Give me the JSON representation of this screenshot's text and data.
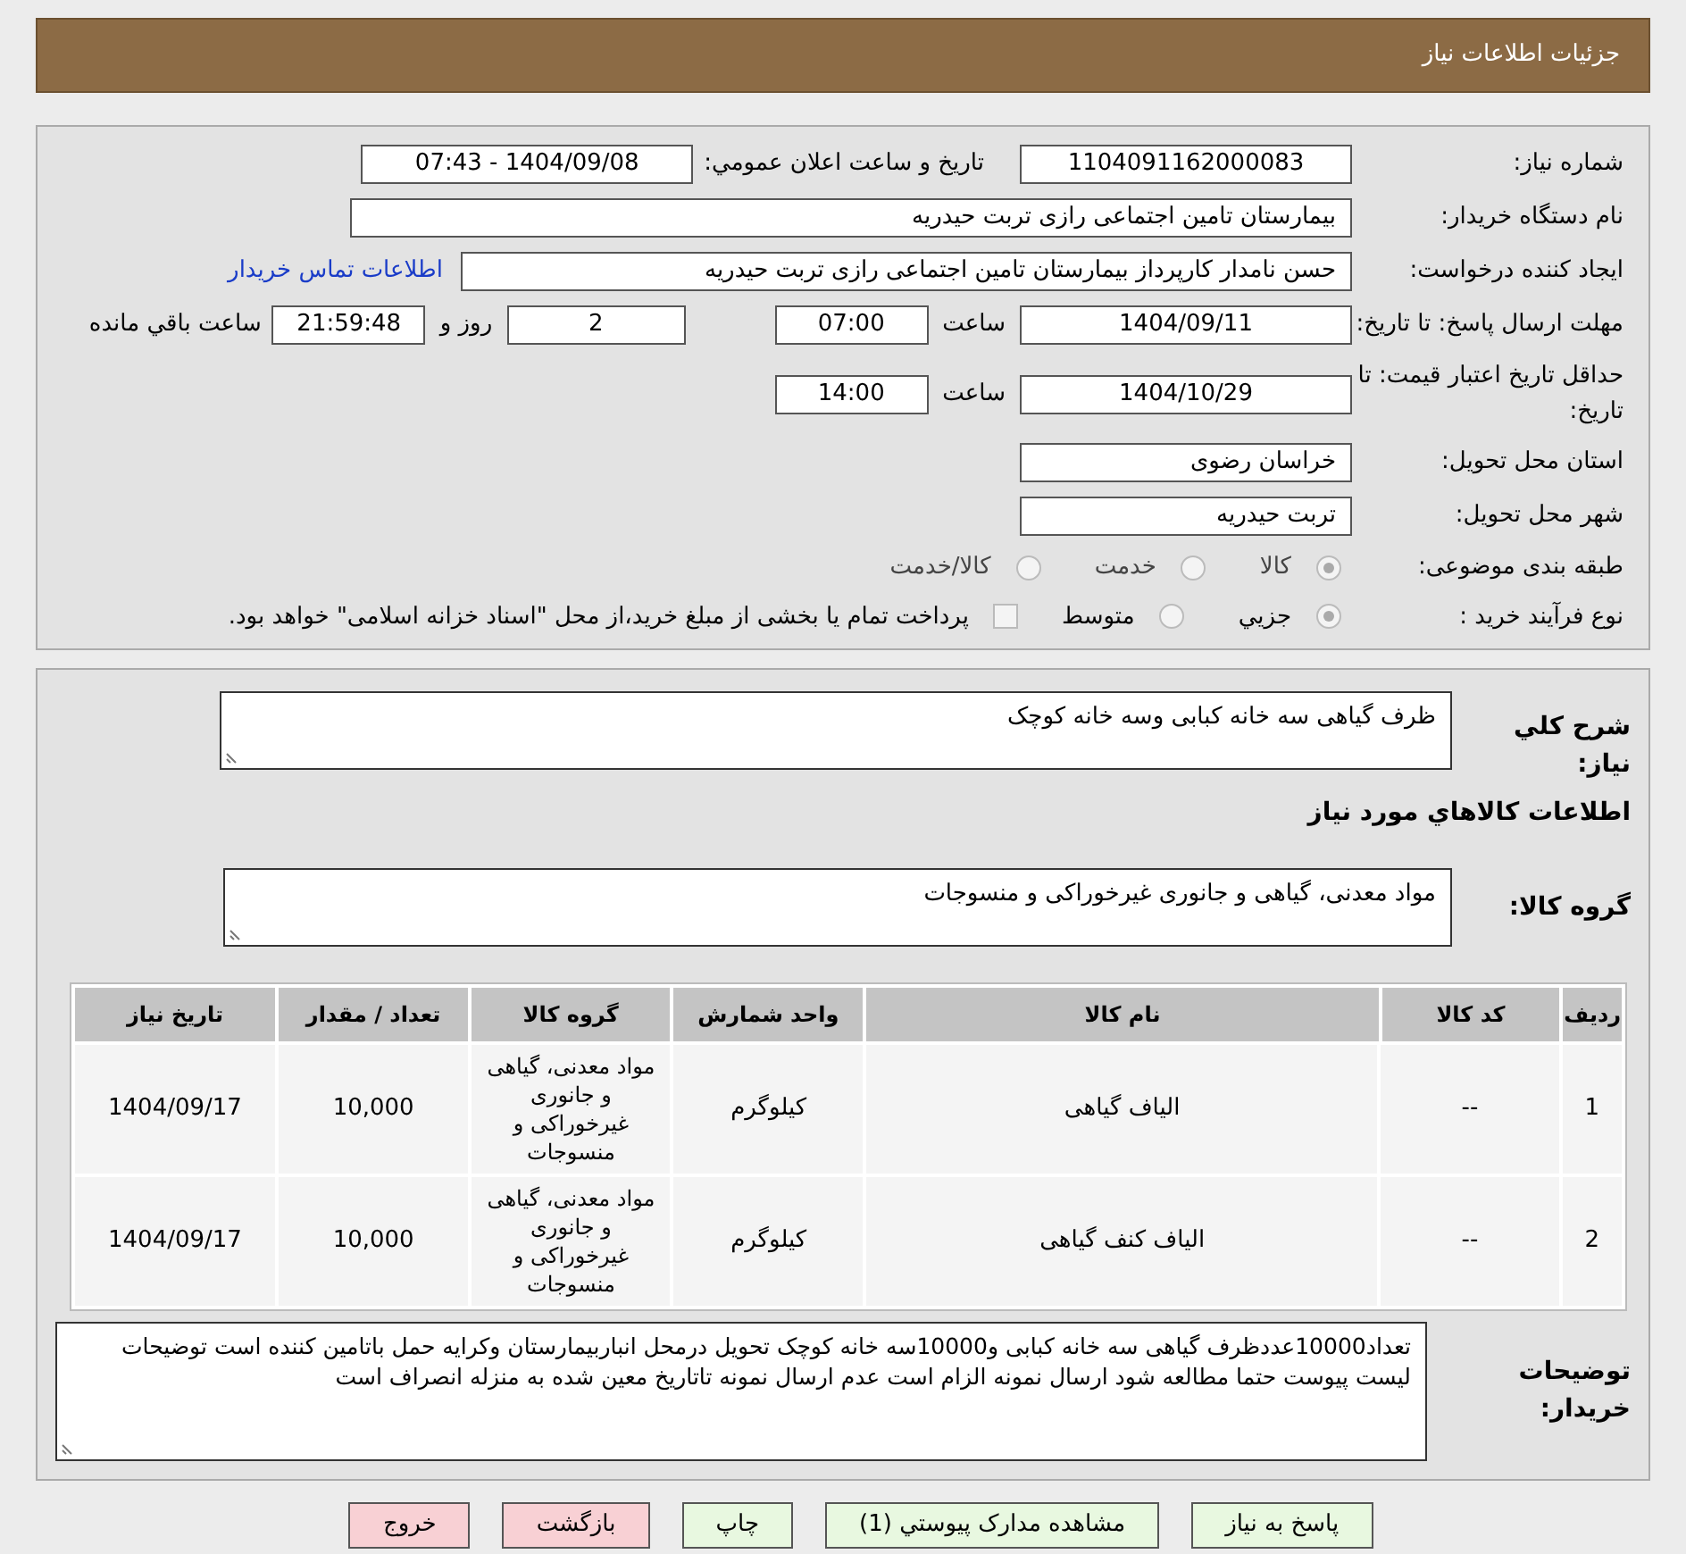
{
  "header": {
    "title": "جزئیات اطلاعات نیاز"
  },
  "need_number": {
    "label": "شماره نیاز:",
    "value": "1104091162000083"
  },
  "announce": {
    "label": "تاريخ و ساعت اعلان عمومي:",
    "value": "1404/09/08 - 07:43"
  },
  "buyer_org": {
    "label": "نام دستگاه خریدار:",
    "value": "بیمارستان تامین اجتماعی رازی تربت حیدریه"
  },
  "requester": {
    "label": "ایجاد کننده درخواست:",
    "value": "حسن نامدار کارپرداز بیمارستان تامین اجتماعی رازی تربت حیدریه",
    "link": "اطلاعات تماس خریدار"
  },
  "deadline": {
    "label": "مهلت ارسال پاسخ: تا تاریخ:",
    "date": "1404/09/11",
    "time_label": "ساعت",
    "time": "07:00",
    "days": "2",
    "days_label": "روز و",
    "remaining": "21:59:48",
    "remaining_label": "ساعت باقي مانده"
  },
  "validity": {
    "label": "حداقل تاریخ اعتبار قیمت: تا تاریخ:",
    "date": "1404/10/29",
    "time_label": "ساعت",
    "time": "14:00"
  },
  "province": {
    "label": "استان محل تحویل:",
    "value": "خراسان رضوی"
  },
  "city": {
    "label": "شهر محل تحویل:",
    "value": "تربت حیدریه"
  },
  "category": {
    "label": "طبقه بندی موضوعی:",
    "options": [
      {
        "label": "کالا",
        "selected": true
      },
      {
        "label": "خدمت",
        "selected": false
      },
      {
        "label": "کالا/خدمت",
        "selected": false
      }
    ]
  },
  "process": {
    "label": "نوع فرآیند خرید :",
    "options": [
      {
        "label": "جزيي",
        "selected": true
      },
      {
        "label": "متوسط",
        "selected": false
      }
    ],
    "payment": {
      "checked": false,
      "text": "پرداخت تمام یا بخشی از مبلغ خرید،از محل \"اسناد خزانه اسلامی\" خواهد بود."
    }
  },
  "description": {
    "label": "شرح کلي نیاز:",
    "value": "ظرف گیاهی سه خانه کبابی وسه خانه کوچک"
  },
  "goods_heading": "اطلاعات کالاهاي مورد نیاز",
  "goods_group": {
    "label": "گروه کالا:",
    "value": "مواد معدنی، گیاهی و جانوری غیرخوراکی و منسوجات"
  },
  "table": {
    "columns": [
      "ردیف",
      "کد کالا",
      "نام کالا",
      "واحد شمارش",
      "گروه کالا",
      "تعداد / مقدار",
      "تاریخ نیاز"
    ],
    "rows": [
      [
        "1",
        "--",
        "الیاف گیاهی",
        "کیلوگرم",
        "مواد معدنی، گیاهی و جانوری غیرخوراکی و منسوجات",
        "10,000",
        "1404/09/17"
      ],
      [
        "2",
        "--",
        "الیاف کنف گیاهی",
        "کیلوگرم",
        "مواد معدنی، گیاهی و جانوری غیرخوراکی و منسوجات",
        "10,000",
        "1404/09/17"
      ]
    ]
  },
  "buyer_notes": {
    "label": "توضیحات خریدار:",
    "value": "تعداد10000عددظرف گیاهی سه خانه کبابی و10000سه خانه کوچک تحویل درمحل انباربیمارستان وکرایه حمل باتامین کننده است توضیحات لیست پیوست حتما مطالعه شود ارسال نمونه الزام است عدم ارسال نمونه تاتاریخ معین شده به منزله انصراف است"
  },
  "buttons": [
    {
      "label": "پاسخ به نیاز",
      "kind": "normal"
    },
    {
      "label": "مشاهده مدارک پیوستي (1)",
      "kind": "normal"
    },
    {
      "label": "چاپ",
      "kind": "normal"
    },
    {
      "label": "بازگشت",
      "kind": "danger"
    },
    {
      "label": "خروج",
      "kind": "danger"
    }
  ]
}
